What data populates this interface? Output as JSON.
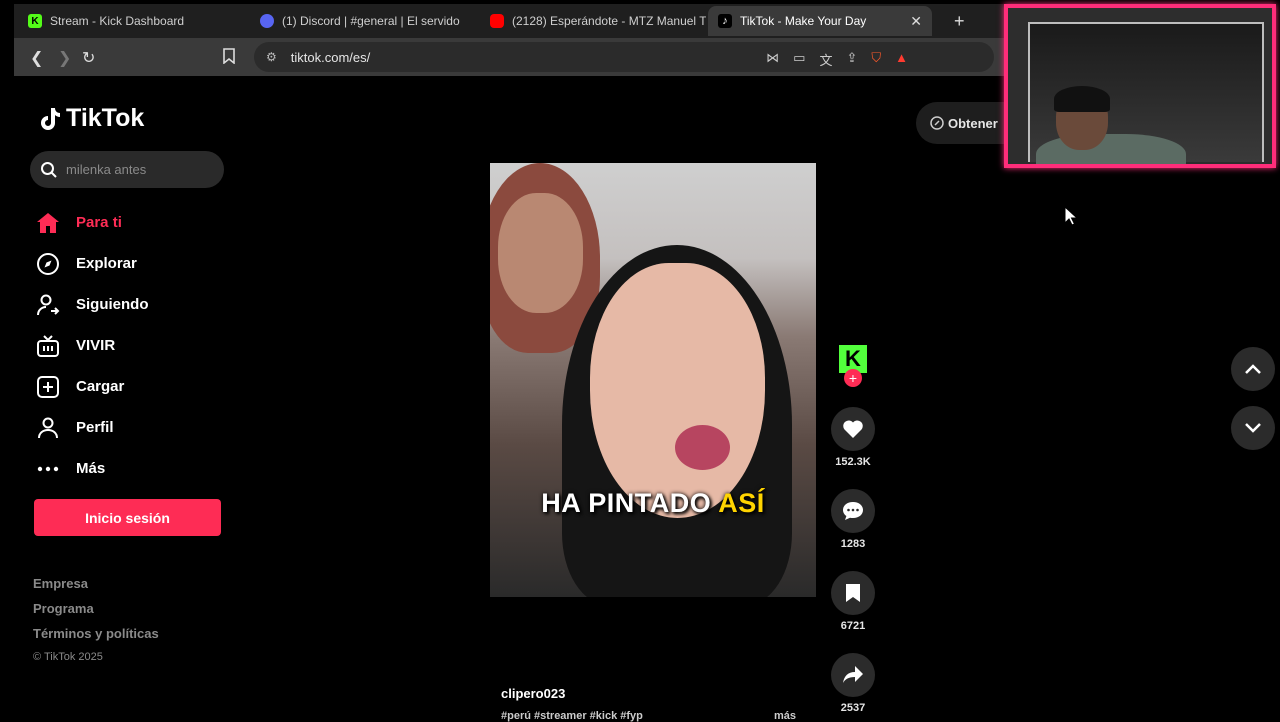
{
  "browser": {
    "tabs": [
      {
        "title": "Stream - Kick Dashboard",
        "fav": "K",
        "fav_color": "#53fc18"
      },
      {
        "title": "(1) Discord | #general | El servido",
        "fav": "",
        "fav_color": "#5865f2"
      },
      {
        "title": "(2128) Esperándote - MTZ Manuel Tu",
        "fav": "",
        "fav_color": "#ff0000"
      },
      {
        "title": "TikTok - Make Your Day",
        "fav": "",
        "fav_color": "#000000"
      }
    ],
    "url": "tiktok.com/es/"
  },
  "sidebar": {
    "brand": "TikTok",
    "search_placeholder": "milenka antes",
    "nav": [
      {
        "label": "Para ti",
        "icon": "home-icon"
      },
      {
        "label": "Explorar",
        "icon": "compass-icon"
      },
      {
        "label": "Siguiendo",
        "icon": "following-icon"
      },
      {
        "label": "VIVIR",
        "icon": "live-icon"
      },
      {
        "label": "Cargar",
        "icon": "upload-icon"
      },
      {
        "label": "Perfil",
        "icon": "profile-icon"
      },
      {
        "label": "Más",
        "icon": "more-icon"
      }
    ],
    "login_label": "Inicio sesión",
    "footer": [
      "Empresa",
      "Programa",
      "Términos y políticas"
    ],
    "copyright": "© TikTok 2025"
  },
  "get_app": "Obtener",
  "video": {
    "caption_main": "HA PINTADO",
    "caption_highlight": "ASÍ",
    "author": "clipero023",
    "hashtags": "#perú #streamer #kick #fyp",
    "more": "más"
  },
  "actions": {
    "likes": "152.3K",
    "comments": "1283",
    "saves": "6721",
    "shares": "2537"
  },
  "colors": {
    "accent": "#fe2c55",
    "kick_green": "#52ff3c",
    "webcam_border": "#ff2d7a"
  }
}
